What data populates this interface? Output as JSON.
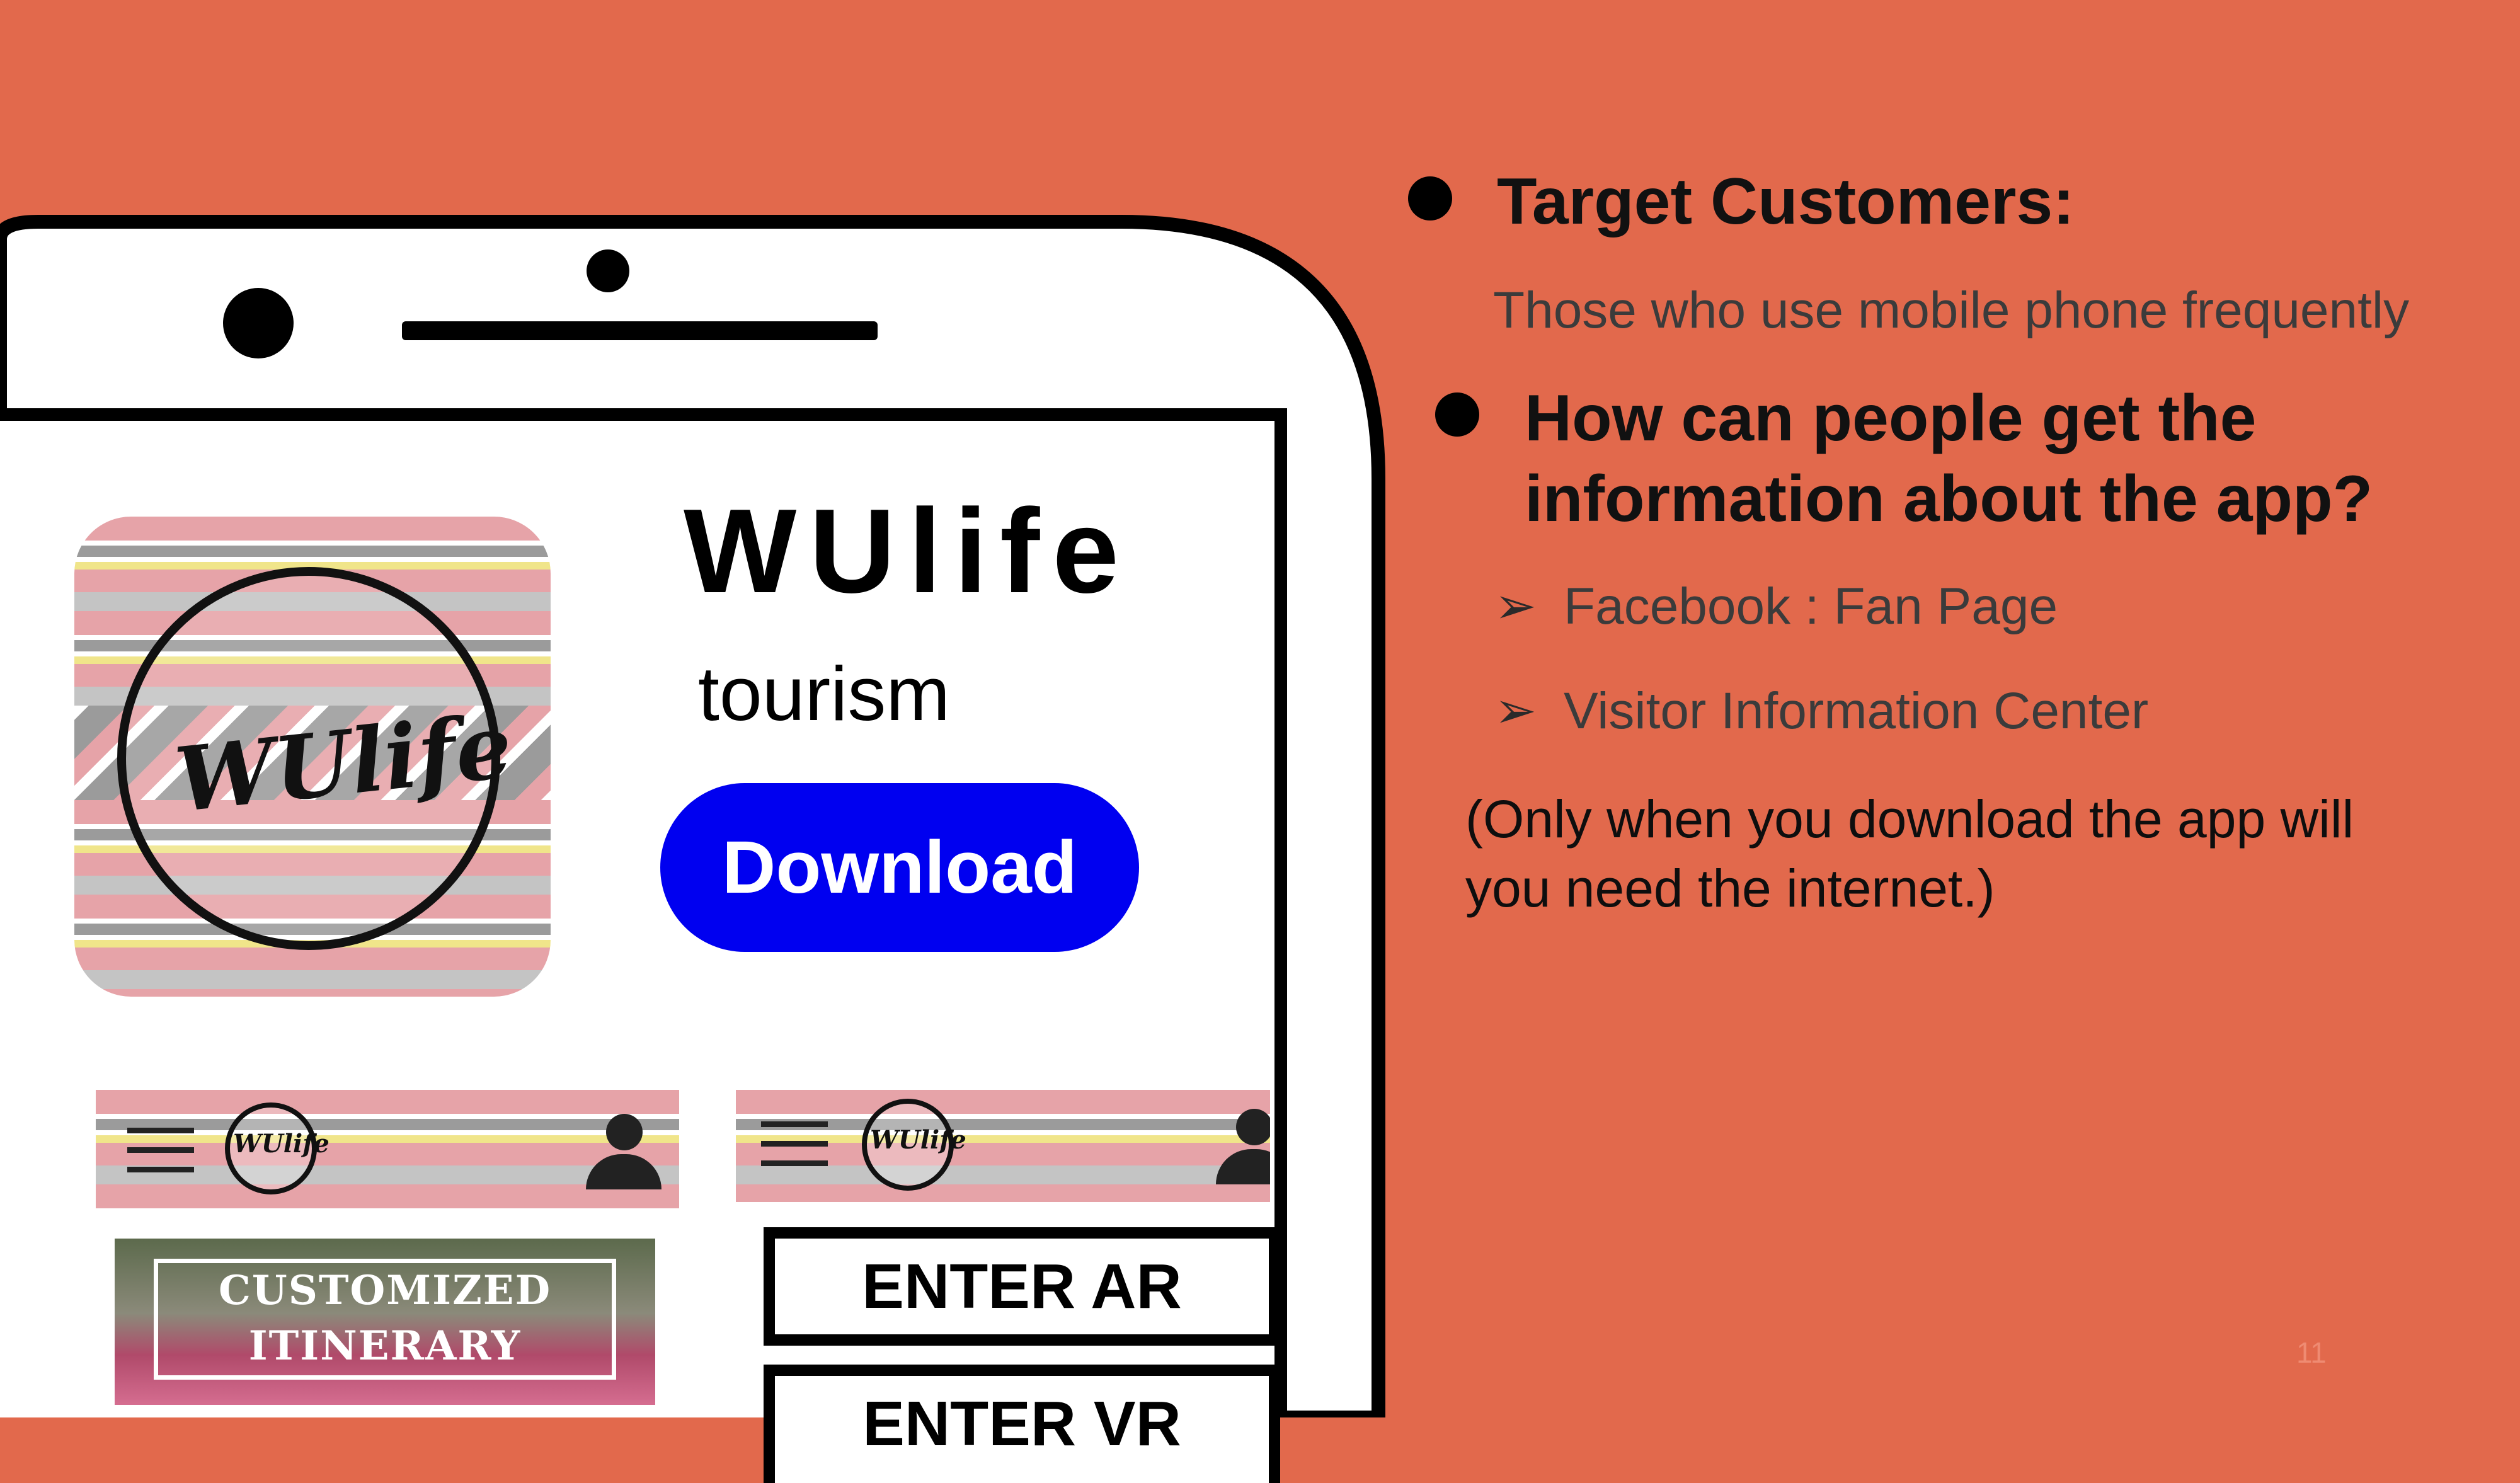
{
  "phone": {
    "app_name": "WUlife",
    "app_category": "tourism",
    "download_label": "Download",
    "logo_text": "WUlife",
    "mini_logo_text": "WUlife",
    "itinerary_line1": "CUSTOMIZED",
    "itinerary_line2": "ITINERARY",
    "enter_ar_label": "ENTER AR",
    "enter_vr_label": "ENTER VR"
  },
  "panel": {
    "heading1": "Target Customers:",
    "subtext1": "Those who use mobile phone frequently",
    "heading2_line1": "How can people get the",
    "heading2_line2": "information about the app?",
    "channels": [
      "Facebook : Fan Page",
      "Visitor Information Center"
    ],
    "note_line1": "(Only when you download the app will",
    "note_line2": "you need the internet.)"
  },
  "slide_number": "11",
  "colors": {
    "background": "#e2694c",
    "download_button": "#0000f0"
  },
  "icons": [
    "hamburger-menu-icon",
    "user-icon",
    "chevron-arrow-icon"
  ]
}
